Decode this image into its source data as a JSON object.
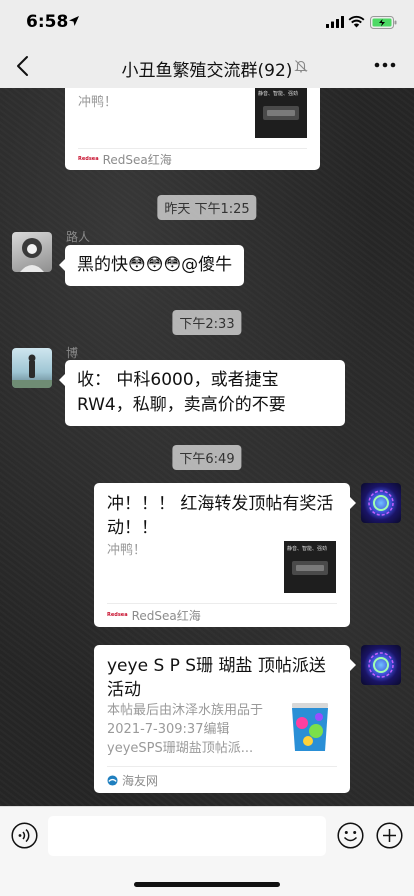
{
  "status_bar": {
    "time": "6:58"
  },
  "header": {
    "title": "小丑鱼繁殖交流群(92)"
  },
  "messages": {
    "card0": {
      "desc": "冲鸭！",
      "source": "RedSea红海",
      "source_logo": "Redsea",
      "thumb_text": "静音、智能、强劲"
    },
    "ts1": "昨天 下午1:25",
    "m1": {
      "sender": "路人",
      "text": "黑的快😳😳😳@傻牛"
    },
    "ts2": "下午2:33",
    "m2": {
      "sender": "博",
      "text": "收： 中科6000，或者捷宝RW4，私聊，卖高价的不要"
    },
    "ts3": "下午6:49",
    "card1": {
      "title": "冲！！！ 红海转发顶帖有奖活动！！",
      "desc": "冲鸭！",
      "source": "RedSea红海",
      "source_logo": "Redsea",
      "thumb_text": "静音、智能、强劲"
    },
    "card2": {
      "title": "yeye S P S珊 瑚盐 顶帖派送活动",
      "desc": "本帖最后由沐泽水族用品于2021-7-309:37编辑 yeyeSPS珊瑚盐顶帖派...",
      "source": "海友网"
    }
  },
  "colors": {
    "nav_bg": "#ededed",
    "bubble": "#ffffff",
    "timestamp_bg": "#cdcdcd",
    "battery": "#4cd964"
  },
  "icons": [
    "location-icon",
    "signal-icon",
    "wifi-icon",
    "battery-icon",
    "back-icon",
    "mute-icon",
    "more-icon",
    "voice-icon",
    "emoji-icon",
    "plus-icon"
  ]
}
